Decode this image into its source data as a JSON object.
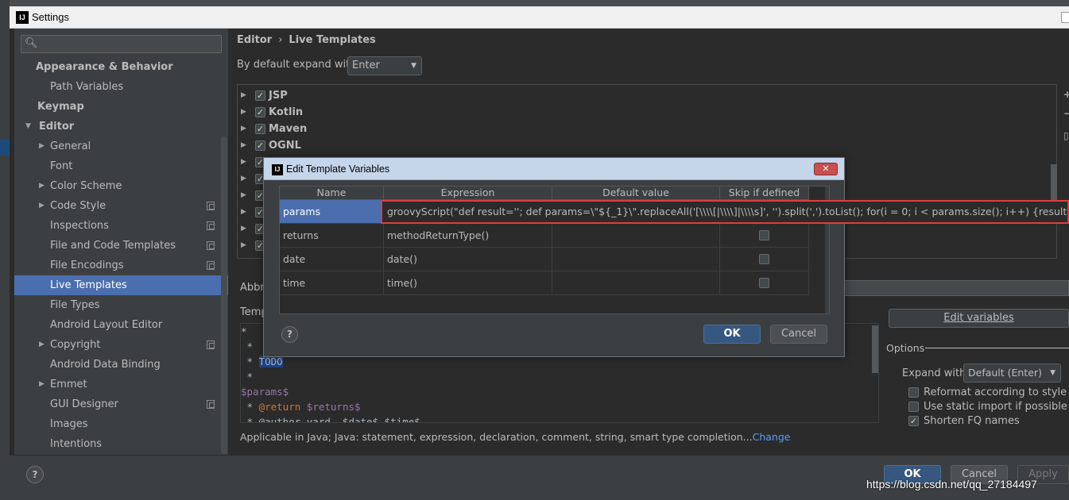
{
  "window": {
    "title": "Settings",
    "logo": "IJ"
  },
  "sidebar": {
    "search_placeholder": "",
    "items": [
      {
        "label": "Appearance & Behavior",
        "bold": true,
        "indent": 1,
        "arrow": ""
      },
      {
        "label": "Path Variables",
        "bold": false,
        "indent": 2,
        "arrow": ""
      },
      {
        "label": "Keymap",
        "bold": true,
        "indent": 1,
        "arrow": ""
      },
      {
        "label": "Editor",
        "bold": true,
        "indent": 1,
        "arrow": "down"
      },
      {
        "label": "General",
        "bold": false,
        "indent": 2,
        "arrow": "right"
      },
      {
        "label": "Font",
        "bold": false,
        "indent": 2,
        "arrow": ""
      },
      {
        "label": "Color Scheme",
        "bold": false,
        "indent": 2,
        "arrow": "right"
      },
      {
        "label": "Code Style",
        "bold": false,
        "indent": 2,
        "arrow": "right",
        "copy": true
      },
      {
        "label": "Inspections",
        "bold": false,
        "indent": 2,
        "arrow": "",
        "copy": true
      },
      {
        "label": "File and Code Templates",
        "bold": false,
        "indent": 2,
        "arrow": "",
        "copy": true
      },
      {
        "label": "File Encodings",
        "bold": false,
        "indent": 2,
        "arrow": "",
        "copy": true
      },
      {
        "label": "Live Templates",
        "bold": false,
        "indent": 2,
        "arrow": "",
        "selected": true
      },
      {
        "label": "File Types",
        "bold": false,
        "indent": 2,
        "arrow": ""
      },
      {
        "label": "Android Layout Editor",
        "bold": false,
        "indent": 2,
        "arrow": ""
      },
      {
        "label": "Copyright",
        "bold": false,
        "indent": 2,
        "arrow": "right",
        "copy": true
      },
      {
        "label": "Android Data Binding",
        "bold": false,
        "indent": 2,
        "arrow": ""
      },
      {
        "label": "Emmet",
        "bold": false,
        "indent": 2,
        "arrow": "right"
      },
      {
        "label": "GUI Designer",
        "bold": false,
        "indent": 2,
        "arrow": "",
        "copy": true
      },
      {
        "label": "Images",
        "bold": false,
        "indent": 2,
        "arrow": ""
      },
      {
        "label": "Intentions",
        "bold": false,
        "indent": 2,
        "arrow": ""
      }
    ]
  },
  "breadcrumb": {
    "parent": "Editor",
    "separator": "›",
    "current": "Live Templates"
  },
  "expand": {
    "label": "By default expand with",
    "value": "Enter"
  },
  "template_groups": [
    "JSP",
    "Kotlin",
    "Maven",
    "OGNL",
    "",
    "",
    "",
    "",
    "",
    ""
  ],
  "fields": {
    "abbreviation_label": "Abbr",
    "template_text_label": "Temp"
  },
  "code_lines": [
    {
      "text": "*"
    },
    {
      "text": " *"
    },
    {
      "text": " * ",
      "sel": "TODO"
    },
    {
      "text": " *"
    },
    {
      "var": "$params$"
    },
    {
      "text": " * ",
      "kw": "@return",
      "var2": " $returns$"
    },
    {
      "text": " * @author yard, $date$ $time$"
    }
  ],
  "edit_variables_button": "Edit variables",
  "options": {
    "title": "Options",
    "expand_with_label": "Expand with",
    "expand_with_value": "Default (Enter)",
    "checks": [
      {
        "label": "Reformat according to style",
        "checked": false
      },
      {
        "label": "Use static import if possible",
        "checked": false
      },
      {
        "label": "Shorten FQ names",
        "checked": true
      }
    ]
  },
  "applicable": {
    "text": "Applicable in Java; Java: statement, expression, declaration, comment, string, smart type completion...",
    "link": "Change"
  },
  "footer": {
    "help": "?",
    "ok": "OK",
    "cancel": "Cancel",
    "apply": "Apply"
  },
  "watermark": "https://blog.csdn.net/qq_27184497",
  "dialog": {
    "title": "Edit Template Variables",
    "close": "✕",
    "columns": [
      "Name",
      "Expression",
      "Default value",
      "Skip if defined"
    ],
    "rows": [
      {
        "name": "params",
        "expression": "groovyScript(\"def result=''; def params=\\\"${_1}\\\".replaceAll('[\\\\\\\\[|\\\\\\\\]|\\\\\\\\s]', '').split(',').toList(); for(i = 0; i < params.size(); i++) {result+=' * @param",
        "default": "",
        "skip": false,
        "editing": true
      },
      {
        "name": "returns",
        "expression": "methodReturnType()",
        "default": "",
        "skip": false
      },
      {
        "name": "date",
        "expression": "date()",
        "default": "",
        "skip": false
      },
      {
        "name": "time",
        "expression": "time()",
        "default": "",
        "skip": false
      }
    ],
    "help": "?",
    "ok": "OK",
    "cancel": "Cancel"
  },
  "colors": {
    "accent": "#4b6eaf",
    "primary_button": "#365880",
    "highlight_border": "#e23c3c",
    "link": "#589df6"
  }
}
